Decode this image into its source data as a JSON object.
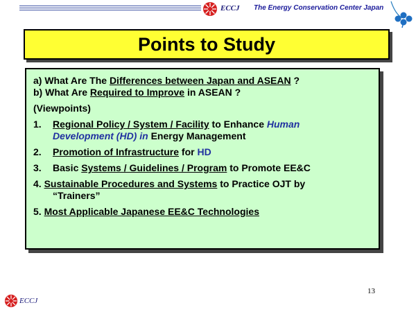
{
  "header": {
    "logo_text": "ECCJ",
    "org_name": "The Energy Conservation Center Japan"
  },
  "title": "Points to Study",
  "content": {
    "q_a": {
      "prefix": "a) What Are The ",
      "underlined": "Differences between Japan and ASEAN",
      "suffix": " ?"
    },
    "q_b": {
      "prefix": "b) What Are ",
      "underlined": "Required to Improve",
      "suffix": " in ASEAN ?"
    },
    "viewpoints": "(Viewpoints)",
    "item1": {
      "num": "1.",
      "underlined": "Regional Policy / System / Facility",
      "mid": " to Enhance ",
      "blue1": "Human",
      "blue2": "Development (HD) in",
      "tail": " Energy Management"
    },
    "item2": {
      "num": "2.",
      "underlined": "Promotion of Infrastructure",
      "mid": " for ",
      "blue": "HD"
    },
    "item3": {
      "num": "3.",
      "prefix": "Basic ",
      "underlined": "Systems / Guidelines / Program",
      "suffix": " to Promote EE&C"
    },
    "item4": {
      "num": "4.",
      "underlined": "Sustainable Procedures and Systems",
      "suffix": " to Practice OJT by",
      "line2": "“Trainers”"
    },
    "item5": {
      "num": "5.",
      "underlined": "Most  Applicable Japanese EE&C Technologies"
    }
  },
  "footer": {
    "logo_text": "ECCJ",
    "page_number": "13"
  }
}
